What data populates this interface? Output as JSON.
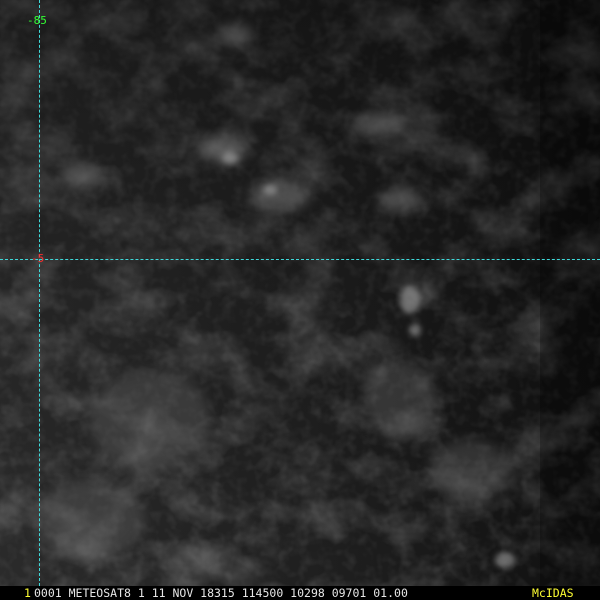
{
  "image": {
    "kind": "satellite-infrared-imagery",
    "palette": [
      "#0a0a0a",
      "#1c1c1c",
      "#2e2e2e",
      "#4a4a4a",
      "#7a7a7a"
    ]
  },
  "overlay": {
    "grid_color": "#3fd9d9",
    "longitude_label": "-85",
    "longitude_label_color": "#33ff33",
    "latitude_label": "-5",
    "latitude_label_color": "#ff2a2a"
  },
  "status_bar": {
    "frame_number": "1",
    "text": "0001 METEOSAT8    1 11 NOV 18315 114500 10298 09701 01.00",
    "mcidas": "McIDAS",
    "highlight_color": "#ffff33"
  }
}
